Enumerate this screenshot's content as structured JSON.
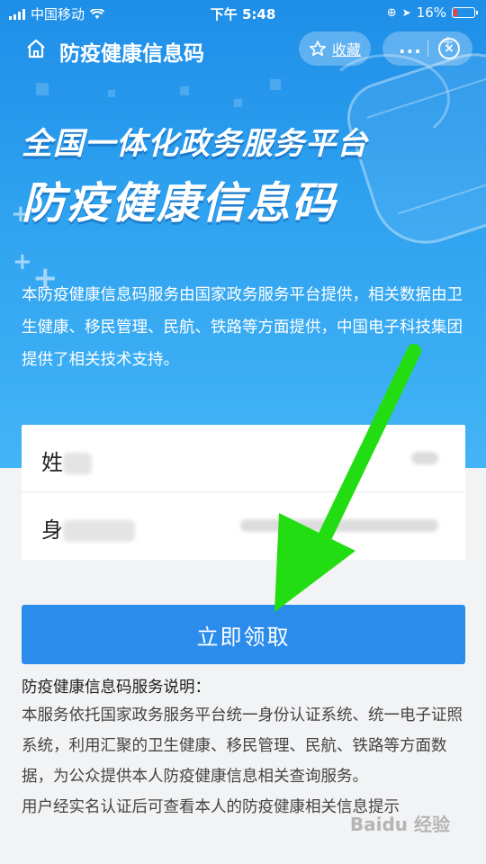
{
  "status_bar": {
    "carrier": "中国移动",
    "time": "下午 5:48",
    "battery_percent": "16%",
    "battery_color": "#ff3b30"
  },
  "nav": {
    "title": "防疫健康信息码",
    "favorite_label": "收藏",
    "home_icon": "home-icon",
    "more_icon": "more-dots-icon",
    "close_icon": "close-circle-icon"
  },
  "hero": {
    "headline1": "全国一体化政务服务平台",
    "headline2": "防疫健康信息码",
    "intro": "本防疫健康信息码服务由国家政务服务平台提供，相关数据由卫生健康、移民管理、民航、铁路等方面提供，中国电子科技集团提供了相关技术支持。"
  },
  "form": {
    "name_label_visible": "姓",
    "id_label_visible": "身"
  },
  "submit": {
    "label": "立即领取",
    "color": "#2b8ceb"
  },
  "notes": {
    "heading": "防疫健康信息码服务说明：",
    "paragraph1": "本服务依托国家政务服务平台统一身份认证系统、统一电子证照系统，利用汇聚的卫生健康、移民管理、民航、铁路等方面数据，为公众提供本人防疫健康信息相关查询服务。",
    "paragraph2": "用户经实名认证后可查看本人的防疫健康相关信息提示"
  },
  "annotation": {
    "arrow_color": "#22dd11"
  },
  "watermark": "Baidu 经验"
}
